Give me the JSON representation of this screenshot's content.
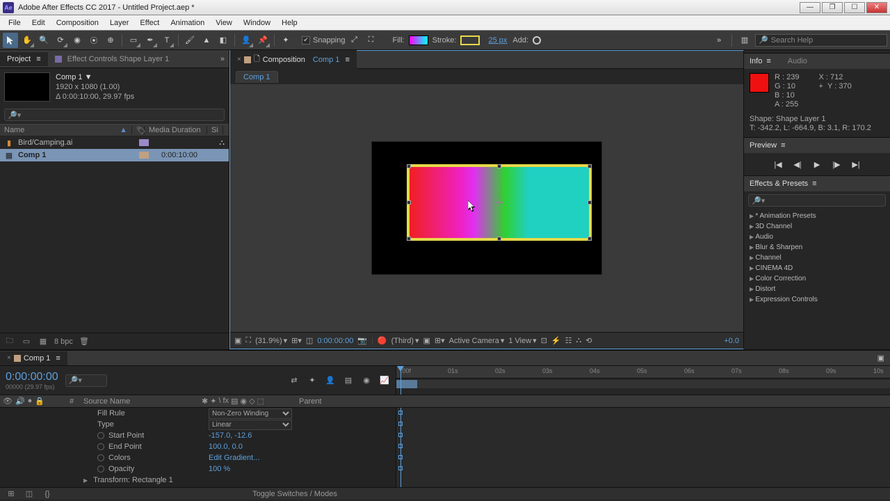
{
  "titlebar": {
    "app_icon": "Ae",
    "title": "Adobe After Effects CC 2017 - Untitled Project.aep *"
  },
  "menubar": [
    "File",
    "Edit",
    "Composition",
    "Layer",
    "Effect",
    "Animation",
    "View",
    "Window",
    "Help"
  ],
  "toolbar": {
    "snapping_label": "Snapping",
    "fill_label": "Fill:",
    "stroke_label": "Stroke:",
    "stroke_width": "25 px",
    "add_label": "Add:",
    "search_placeholder": "Search Help"
  },
  "project_panel": {
    "tab_project": "Project",
    "tab_fx": "Effect Controls Shape Layer 1",
    "comp_name": "Comp 1 ▼",
    "comp_res": "1920 x 1080 (1.00)",
    "comp_dur": "Δ 0:00:10:00, 29.97 fps",
    "cols": {
      "name": "Name",
      "media": "Media Duration",
      "size": "Si"
    },
    "items": [
      {
        "icon": "📄",
        "name": "Bird/Camping.ai",
        "dur": ""
      },
      {
        "icon": "▦",
        "name": "Comp 1",
        "dur": "0:00:10:00",
        "comp": true
      }
    ],
    "bpc": "8 bpc"
  },
  "comp_panel": {
    "tab_label": "Composition",
    "comp_link": "Comp 1",
    "subtab": "Comp 1",
    "footer": {
      "zoom": "(31.9%)",
      "time": "0:00:00:00",
      "quality": "(Third)",
      "camera": "Active Camera",
      "view": "1 View",
      "exposure": "+0.0"
    }
  },
  "info_panel": {
    "tab_info": "Info",
    "tab_audio": "Audio",
    "rgba": {
      "r": "R : 239",
      "g": "G : 10",
      "b": "B : 10",
      "a": "A : 255"
    },
    "xy": {
      "x": "X : 712",
      "y": "Y : 370"
    },
    "shape_name": "Shape: Shape Layer 1",
    "shape_bounds": "T: -342.2, L: -664.9, B: 3.1, R: 170.2"
  },
  "preview_panel": {
    "title": "Preview"
  },
  "effects_panel": {
    "title": "Effects & Presets",
    "items": [
      "* Animation Presets",
      "3D Channel",
      "Audio",
      "Blur & Sharpen",
      "Channel",
      "CINEMA 4D",
      "Color Correction",
      "Distort",
      "Expression Controls"
    ]
  },
  "timeline": {
    "tab": "Comp 1",
    "time": "0:00:00:00",
    "subtime": "00000 (29.97 fps)",
    "cols": {
      "src": "Source Name",
      "parent": "Parent"
    },
    "ruler_ticks": [
      ":00f",
      "01s",
      "02s",
      "03s",
      "04s",
      "05s",
      "06s",
      "07s",
      "08s",
      "09s",
      "10s"
    ],
    "props": [
      {
        "name": "Fill Rule",
        "val": "Non-Zero Winding",
        "dropdown": true
      },
      {
        "name": "Type",
        "val": "Linear",
        "dropdown": true
      },
      {
        "name": "Start Point",
        "val": "-157.0, -12.6",
        "stopwatch": true
      },
      {
        "name": "End Point",
        "val": "100.0, 0.0",
        "stopwatch": true
      },
      {
        "name": "Colors",
        "val": "Edit Gradient...",
        "stopwatch": true
      },
      {
        "name": "Opacity",
        "val": "100 %",
        "stopwatch": true
      }
    ],
    "transform_row": "Transform: Rectangle 1",
    "toggle_label": "Toggle Switches / Modes"
  }
}
